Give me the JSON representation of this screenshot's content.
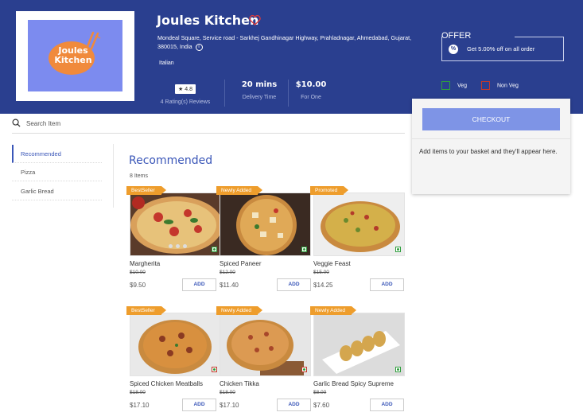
{
  "restaurant": {
    "logo_text_line1": "Joules",
    "logo_text_line2": "Kitchen",
    "name": "Joules Kitchen",
    "address": "Mondeal Square, Service road - Sarkhej Gandhinagar Highway, Prahladnagar, Ahmedabad, Gujarat, 380015, India",
    "cuisine": "Italian"
  },
  "stats": {
    "rating": "4.8",
    "reviews": "4 Rating(s) Reviews",
    "delivery_time": "20 mins",
    "delivery_label": "Delivery Time",
    "price_for_one": "$10.00",
    "price_label": "For One"
  },
  "offer": {
    "title": "OFFER",
    "text": "Get 5.00% off on all order"
  },
  "filters": {
    "veg": "Veg",
    "non_veg": "Non Veg"
  },
  "cart": {
    "checkout_label": "CHECKOUT",
    "empty_message": "Add items to your basket and they'll appear here."
  },
  "search": {
    "placeholder": "Search Item"
  },
  "sidebar": {
    "items": [
      {
        "label": "Recommended"
      },
      {
        "label": "Pizza"
      },
      {
        "label": "Garlic Bread"
      }
    ]
  },
  "section": {
    "title": "Recommended",
    "count": "8 Items"
  },
  "products": [
    {
      "tag": "BestSeller",
      "name": "Margherita",
      "old_price": "$10.00",
      "price": "$9.50",
      "add": "ADD"
    },
    {
      "tag": "Newly Added",
      "name": "Spiced Paneer",
      "old_price": "$12.00",
      "price": "$11.40",
      "add": "ADD"
    },
    {
      "tag": "Promoted",
      "name": "Veggie Feast",
      "old_price": "$15.00",
      "price": "$14.25",
      "add": "ADD"
    },
    {
      "tag": "BestSeller",
      "name": "Spiced Chicken Meatballs",
      "old_price": "$18.00",
      "price": "$17.10",
      "add": "ADD"
    },
    {
      "tag": "Newly Added",
      "name": "Chicken Tikka",
      "old_price": "$18.00",
      "price": "$17.10",
      "add": "ADD"
    },
    {
      "tag": "Newly Added",
      "name": "Garlic Bread Spicy Supreme",
      "old_price": "$8.00",
      "price": "$7.60",
      "add": "ADD"
    }
  ],
  "colors": {
    "header_bg": "#2a3f8f",
    "accent": "#3a56b8",
    "checkout_bg": "#7e94e6",
    "tag_bg": "#ee9d2c",
    "veg": "#2e9e3d",
    "non_veg": "#c0392b"
  }
}
